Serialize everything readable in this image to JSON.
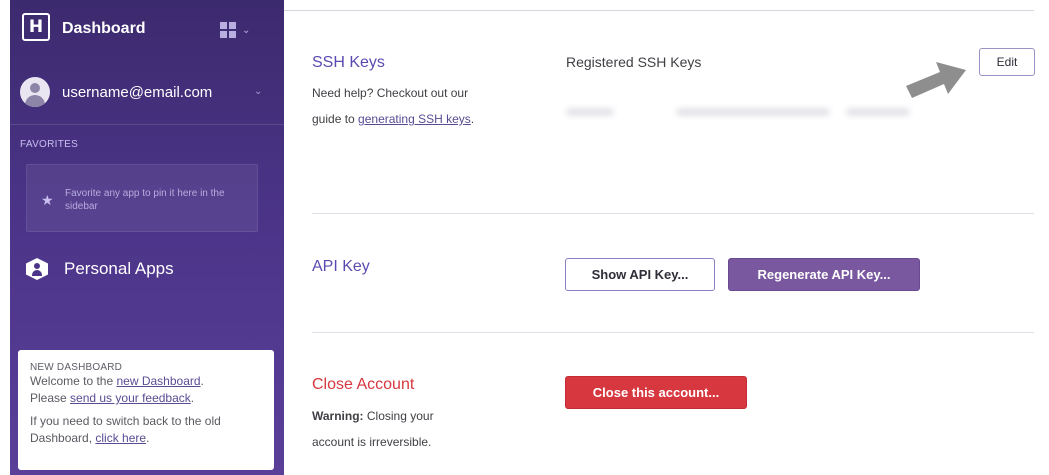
{
  "sidebar": {
    "logo_letter": "H",
    "title": "Dashboard",
    "apps_icon": "grid-icon",
    "user": {
      "email": "username@email.com",
      "avatar_icon": "user-avatar-icon"
    },
    "favorites": {
      "label": "FAVORITES",
      "empty_text": "Favorite any app to pin it here in the sidebar",
      "icon": "star-icon"
    },
    "personal_apps": {
      "label": "Personal Apps",
      "icon": "person-hex-icon"
    },
    "new_dashboard": {
      "title": "NEW DASHBOARD",
      "line1_prefix": "Welcome to the ",
      "line1_link": "new Dashboard",
      "line1_suffix": ".",
      "line2_prefix": "Please ",
      "line2_link": "send us your feedback",
      "line2_suffix": ".",
      "line3_prefix": "If you need to switch back to the old Dashboard, ",
      "line3_link": "click here",
      "line3_suffix": "."
    }
  },
  "ssh": {
    "title": "SSH Keys",
    "help_prefix": "Need help? Checkout out our guide to ",
    "help_link": "generating SSH keys",
    "help_suffix": ".",
    "registered_label": "Registered SSH Keys",
    "edit_label": "Edit"
  },
  "api": {
    "title": "API Key",
    "show_label": "Show API Key...",
    "regenerate_label": "Regenerate API Key..."
  },
  "close": {
    "title": "Close Account",
    "warning_bold": "Warning:",
    "warning_text": " Closing your account is irreversible.",
    "button_label": "Close this account..."
  },
  "colors": {
    "sidebar": "#4b3488",
    "accent": "#79589f",
    "danger": "#d7373f"
  }
}
